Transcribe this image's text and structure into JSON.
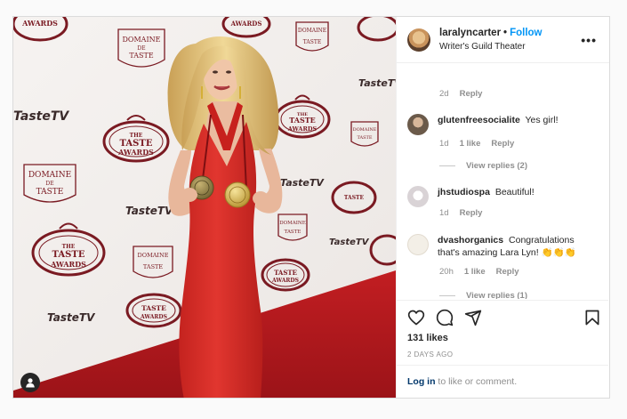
{
  "post": {
    "username": "laralyncarter",
    "separator": "•",
    "follow_label": "Follow",
    "location": "Writer's Guild Theater",
    "more_label": "•••"
  },
  "backdrop_logos": {
    "domaine_top": "DOMAINE",
    "domaine_mid": "DE",
    "domaine_bottom": "TASTE",
    "awards_top": "THE",
    "awards_mid": "TASTE",
    "awards_bottom": "AWARDS",
    "tastetv": "TasteTV"
  },
  "comments": [
    {
      "username": "",
      "text": "",
      "time": "2d",
      "likes": "",
      "reply_label": "Reply",
      "avatar": "none"
    },
    {
      "username": "glutenfreesocialite",
      "text": "Yes girl!",
      "time": "1d",
      "likes": "1 like",
      "reply_label": "Reply",
      "view_replies": "View replies (2)",
      "avatar_color": "#6b5a4a"
    },
    {
      "username": "jhstudiospa",
      "text": "Beautiful!",
      "time": "1d",
      "likes": "",
      "reply_label": "Reply",
      "avatar_color": "#d9d3d6"
    },
    {
      "username": "dvashorganics",
      "text": "Congratulations that's amazing Lara Lyn! 👏👏👏",
      "time": "20h",
      "likes": "1 like",
      "reply_label": "Reply",
      "view_replies": "View replies (1)",
      "avatar_color": "#f3efe7"
    }
  ],
  "actions": {
    "like_icon": "heart-icon",
    "comment_icon": "comment-icon",
    "share_icon": "paper-plane-icon",
    "save_icon": "bookmark-icon",
    "likes_text": "131 likes",
    "date_text": "2 DAYS AGO"
  },
  "login": {
    "link_text": "Log in",
    "rest_text": " to like or comment."
  },
  "colors": {
    "accent": "#0095f6",
    "dress": "#d92f2b",
    "carpet": "#b3191d",
    "logo": "#7a1a22"
  }
}
